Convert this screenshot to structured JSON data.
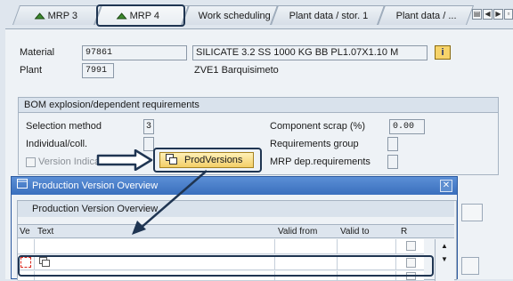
{
  "tabs": [
    {
      "label": "MRP 3"
    },
    {
      "label": "MRP 4"
    },
    {
      "label": "Work scheduling"
    },
    {
      "label": "Plant data / stor. 1"
    },
    {
      "label": "Plant data / ..."
    }
  ],
  "header": {
    "material_label": "Material",
    "material_value": "97861",
    "material_desc": "SILICATE 3.2 SS 1000 KG BB PL1.07X1.10 M",
    "plant_label": "Plant",
    "plant_value": "7991",
    "plant_desc": "ZVE1 Barquisimeto",
    "info_icon": "i"
  },
  "bom_group": {
    "title": "BOM explosion/dependent requirements",
    "selection_method_label": "Selection method",
    "selection_method_value": "3",
    "individual_label": "Individual/coll.",
    "version_indicator_label": "Version Indicat",
    "component_scrap_label": "Component scrap (%)",
    "component_scrap_value": "0.00",
    "requirements_group_label": "Requirements group",
    "mrp_dep_label": "MRP dep.requirements",
    "prodversions_button": "ProdVersions"
  },
  "dialog": {
    "title": "Production Version Overview",
    "subtitle": "Production Version Overview",
    "columns": {
      "ve": "Ve",
      "text": "Text",
      "valid_from": "Valid from",
      "valid_to": "Valid to",
      "r": "R"
    }
  },
  "colors": {
    "accent_blue": "#3a6fbd",
    "button_yellow": "#f3cf68",
    "annotation_navy": "#1f3552",
    "red_cursor": "#d9261c"
  }
}
